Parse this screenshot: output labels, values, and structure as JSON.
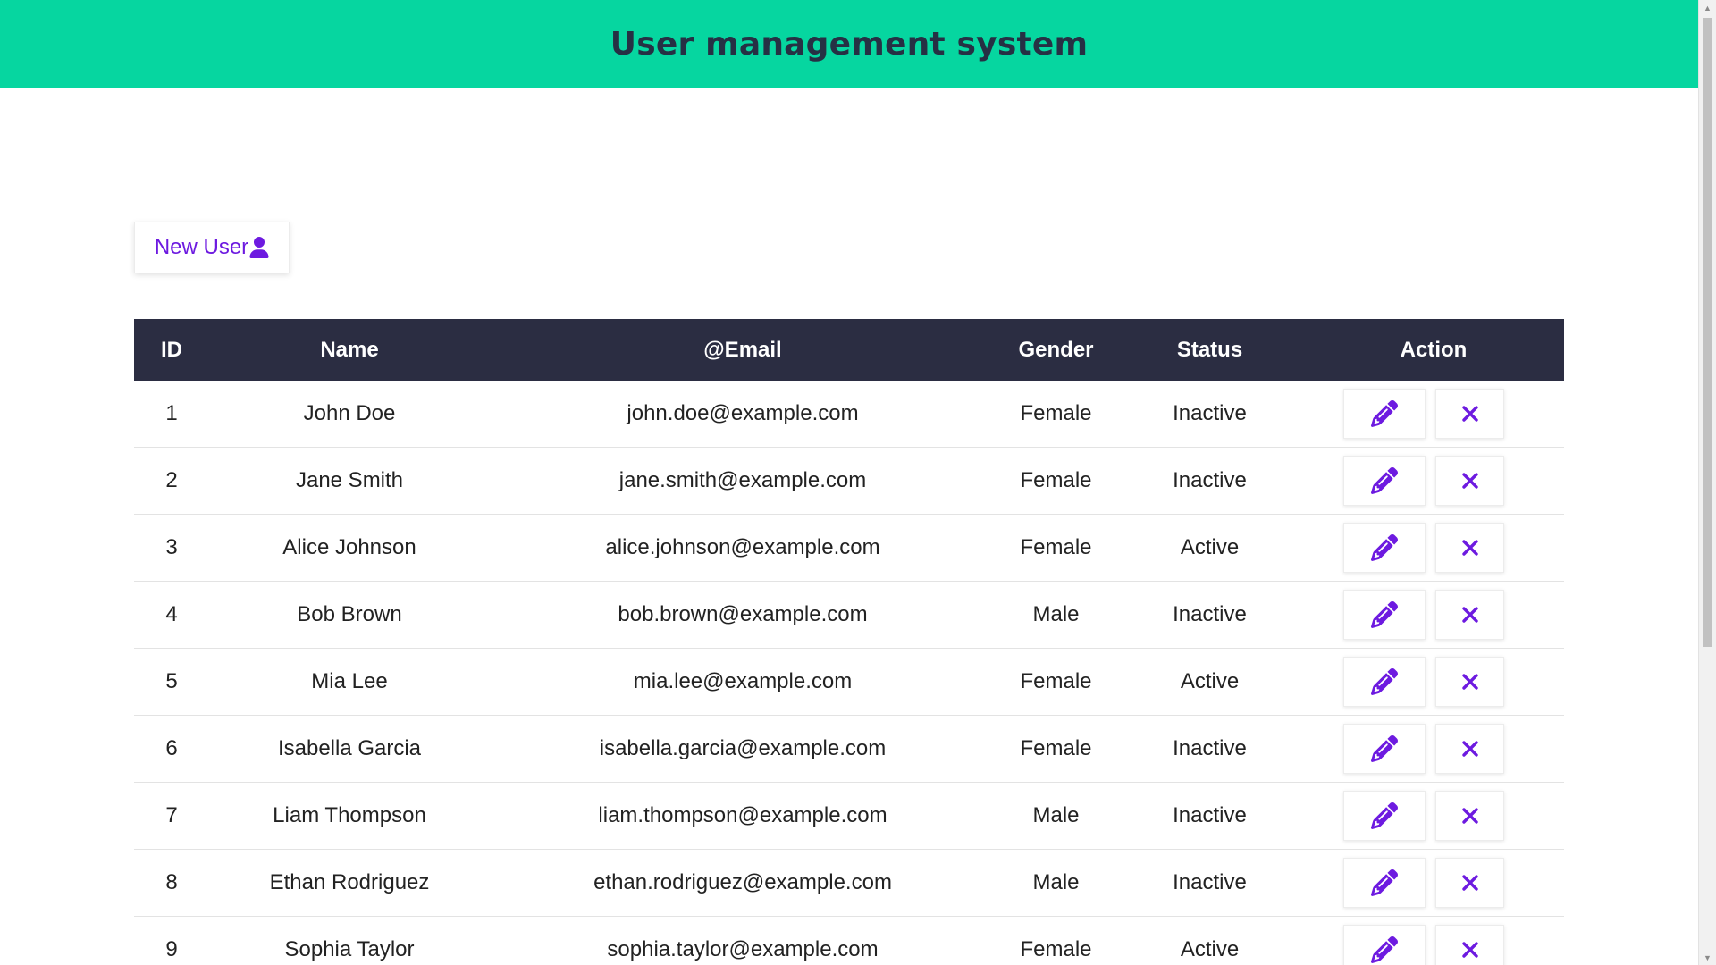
{
  "header": {
    "title": "User management system"
  },
  "toolbar": {
    "new_user_label": "New User",
    "new_user_icon": "user-icon"
  },
  "table": {
    "columns": [
      "ID",
      "Name",
      "@Email",
      "Gender",
      "Status",
      "Action"
    ],
    "rows": [
      {
        "id": "1",
        "name": "John Doe",
        "email": "john.doe@example.com",
        "gender": "Female",
        "status": "Inactive"
      },
      {
        "id": "2",
        "name": "Jane Smith",
        "email": "jane.smith@example.com",
        "gender": "Female",
        "status": "Inactive"
      },
      {
        "id": "3",
        "name": "Alice Johnson",
        "email": "alice.johnson@example.com",
        "gender": "Female",
        "status": "Active"
      },
      {
        "id": "4",
        "name": "Bob Brown",
        "email": "bob.brown@example.com",
        "gender": "Male",
        "status": "Inactive"
      },
      {
        "id": "5",
        "name": "Mia Lee",
        "email": "mia.lee@example.com",
        "gender": "Female",
        "status": "Active"
      },
      {
        "id": "6",
        "name": "Isabella Garcia",
        "email": "isabella.garcia@example.com",
        "gender": "Female",
        "status": "Inactive"
      },
      {
        "id": "7",
        "name": "Liam Thompson",
        "email": "liam.thompson@example.com",
        "gender": "Male",
        "status": "Inactive"
      },
      {
        "id": "8",
        "name": "Ethan Rodriguez",
        "email": "ethan.rodriguez@example.com",
        "gender": "Male",
        "status": "Inactive"
      },
      {
        "id": "9",
        "name": "Sophia Taylor",
        "email": "sophia.taylor@example.com",
        "gender": "Female",
        "status": "Active"
      }
    ],
    "edit_icon": "pencil-icon",
    "delete_icon": "close-icon"
  },
  "colors": {
    "header_bg": "#06d6a0",
    "header_text": "#263044",
    "table_header_bg": "#2b2d42",
    "accent": "#6d1ae0"
  }
}
